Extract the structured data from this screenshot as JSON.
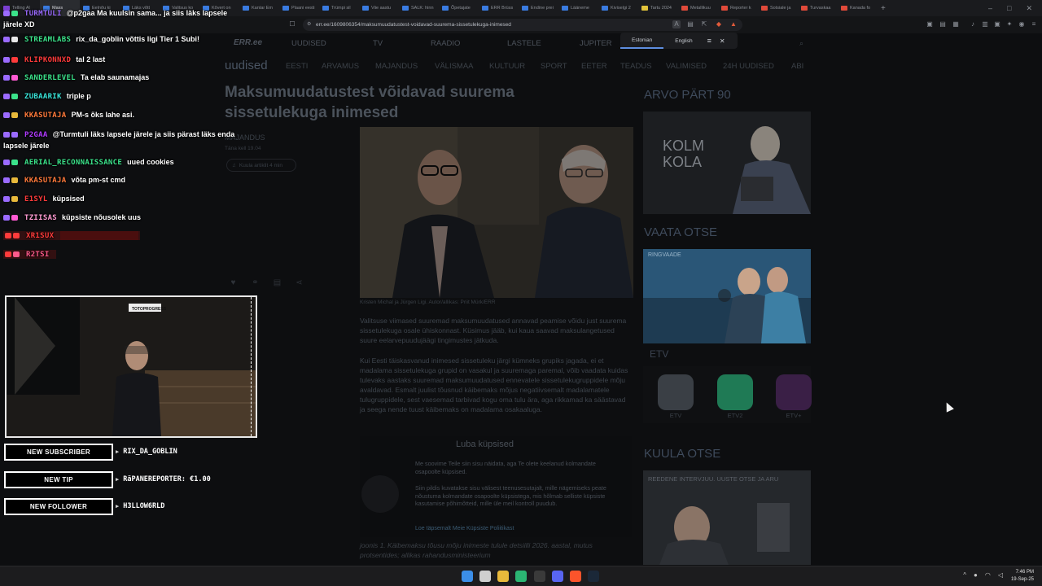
{
  "browser": {
    "tabs": [
      {
        "label": "Telling Al",
        "color": "#7a3fd1"
      },
      {
        "label": "Mass",
        "color": "#3a7be0"
      },
      {
        "label": "Eelnõu ki",
        "color": "#3a7be0"
      },
      {
        "label": "Läks võtt",
        "color": "#3a7be0"
      },
      {
        "label": "Valitsus ko",
        "color": "#3a7be0"
      },
      {
        "label": "Kõvert on",
        "color": "#3a7be0"
      },
      {
        "label": "Kantar Em",
        "color": "#3a7be0"
      },
      {
        "label": "Plaani eesti",
        "color": "#3a7be0"
      },
      {
        "label": "Trümpi sil",
        "color": "#3a7be0"
      },
      {
        "label": "Viie aastu",
        "color": "#3a7be0"
      },
      {
        "label": "SALK: hinn",
        "color": "#3a7be0"
      },
      {
        "label": "Õpetajate",
        "color": "#3a7be0"
      },
      {
        "label": "ERR Brüss",
        "color": "#3a7be0"
      },
      {
        "label": "Endine prei",
        "color": "#3a7be0"
      },
      {
        "label": "Lääneme",
        "color": "#3a7be0"
      },
      {
        "label": "Kiviselgi 2",
        "color": "#3a7be0"
      },
      {
        "label": "Tartu 2024",
        "color": "#e0c23a"
      },
      {
        "label": "Metallikuu",
        "color": "#e04a3a"
      },
      {
        "label": "Reporter k",
        "color": "#e04a3a"
      },
      {
        "label": "Sotsiale ja",
        "color": "#e04a3a"
      },
      {
        "label": "Turvaskaa",
        "color": "#e04a3a"
      },
      {
        "label": "Kanada fo",
        "color": "#e04a3a"
      }
    ],
    "active_tab_index": 1,
    "url": "err.ee/1609806354/maksumuudatustest-voidavad-suurema-sissetulekuga-inimesed",
    "window_buttons": [
      "–",
      "□",
      "✕"
    ]
  },
  "language_popup": {
    "options": [
      "Estonian",
      "English"
    ],
    "selected": "Estonian"
  },
  "site": {
    "logo": "ERR.ee",
    "top_nav": [
      "UUDISED",
      "TV",
      "RAADIO",
      "LASTELE",
      "JUPITER"
    ],
    "section_title": "uudised",
    "sub_nav": [
      "EESTI",
      "ARVAMUS",
      "MAJANDUS",
      "VÄLISMAA",
      "KULTUUR",
      "SPORT",
      "EETER",
      "TEADUS",
      "VALIMISED",
      "24H UUDISED",
      "ABI"
    ],
    "article": {
      "title": "Maksumuudatustest võidavad suurema sissetulekuga inimesed",
      "category": "MAJANDUS",
      "date": "Täna kell 19.04",
      "listen": "Kuula artiklit 4 min",
      "caption": "Kristen Michal ja Jürgen Ligi. Autor/allikas: Priit Mürk/ERR",
      "paragraphs": [
        "Valitsuse viimased suuremad maksumuudatused annavad peamise võidu just suurema sissetulekuga osale ühiskonnast. Küsimus jääb, kui kaua saavad maksulangetused suure eelarvepuudujäägi tingimustes jätkuda.",
        "Kui Eesti täiskasvanud inimesed sissetuleku järgi kümneks grupiks jagada, ei et madalama sissetulekuga grupid on vasakul ja suuremaga paremal, võib vaadata kuidas tulevaks aastaks suuremad maksumuudatused ennevatele sissetulekugruppidele mõju avaldavad. Esmalt juulist tõusnud käibemaks mõjus negatiivsemalt madalamatele tulugruppidele, sest vaesemad tarbivad kogu oma tulu ära, aga rikkamad ka säästavad ja seega nende tuust käibemaks on madalama osakaaluga."
      ],
      "after_cookie": "joonis 1. Käibemaksu tõusu mõju inimeste tulule detsiilli 2026. aastal, mutus protsentides; allikas rahandusministeerium"
    },
    "cookie": {
      "title": "Luba küpsised",
      "text1": "Me soovime Teile siin sisu näidata, aga Te olete keelanud kolmandate osapoolte küpsised.",
      "text2": "Siin pildis kuvatakse sisu välisest teenusesutajalt, mille nägemiseks peate nõustuma kolmandate osapoolte küpsistega, mis hõlmab selliste küpsiste kasutamise põhimõtteid, mille üle meil kontroll puudub.",
      "link": "Loe täpsemalt Meie Küpsiste Poliitikast"
    },
    "sidebar": {
      "arvo_heading": "ARVO PÄRT 90",
      "arvo_card_text": "KOLM KOLA",
      "vaata_heading": "VAATA OTSE",
      "vaata_card_label": "RINGVAADE",
      "etv_label": "ETV",
      "channels": [
        {
          "name": "ETV",
          "color": "#3a3f45"
        },
        {
          "name": "ETV2",
          "color": "#1f7a55"
        },
        {
          "name": "ETV+",
          "color": "#5a2a6a"
        }
      ],
      "kuula_heading": "KUULA OTSE",
      "kuula_text": "REEDENE INTERVJUU. UUSTE OTSE JA ARU"
    }
  },
  "stream_overlay": {
    "chat": [
      {
        "name": "TURMTULI",
        "msg": "@p2gaa Ma kuulsin sama... ja siis läks lapsele järele XD",
        "name_color": "#9b6bff"
      },
      {
        "name": "STREAMLABS",
        "msg": "rix_da_goblin võttis ligi Tier 1 Subi!",
        "name_color": "#3be28a"
      },
      {
        "name": "KLIPKONNXD",
        "msg": "tal 2 last",
        "name_color": "#ff3b3b"
      },
      {
        "name": "SANDERLEVEL",
        "msg": "Ta elab saunamajas",
        "name_color": "#3be28a"
      },
      {
        "name": "ZUBAARIK",
        "msg": "triple p",
        "name_color": "#39e3d8"
      },
      {
        "name": "KKASUTAJA",
        "msg": "PM-s õks lahe asi.",
        "name_color": "#ff7a3b"
      },
      {
        "name": "P2GAA",
        "msg": "@Turmtuli läks lapsele järele ja siis pärast läks enda lapsele järele",
        "name_color": "#b03bff"
      },
      {
        "name": "AERIAL_RECONNAISSANCE",
        "msg": "uued cookies",
        "name_color": "#3be28a"
      },
      {
        "name": "KKASUTAJA",
        "msg": "võta pm-st cmd",
        "name_color": "#ff7a3b"
      },
      {
        "name": "E1SYL",
        "msg": "küpsised",
        "name_color": "#ff3b3b"
      },
      {
        "name": "TZIISAS",
        "msg": "küpsiste nõusolek uus",
        "name_color": "#ff9bd2"
      },
      {
        "name": "XR1SUX",
        "msg": "",
        "name_color": "#ff3b3b"
      },
      {
        "name": "R2TSI",
        "msg": "",
        "name_color": "#ff5a8a"
      }
    ],
    "webcam_banner": "TOTOPROGRESS",
    "alerts": [
      {
        "label": "NEW SUBSCRIBER",
        "value": "RIX_DA_GOBLIN"
      },
      {
        "label": "NEW TIP",
        "value": "RäPANEREPORTER: €1.00"
      },
      {
        "label": "NEW FOLLOWER",
        "value": "H3LLOW6RLD"
      }
    ]
  },
  "taskbar": {
    "apps": [
      {
        "name": "windows-start",
        "color": "#3b8ee8"
      },
      {
        "name": "search",
        "color": "#cfcfcf"
      },
      {
        "name": "file-explorer",
        "color": "#e8b93b"
      },
      {
        "name": "terminal",
        "color": "#2bb673"
      },
      {
        "name": "obs",
        "color": "#3a3a3a"
      },
      {
        "name": "discord",
        "color": "#5865f2"
      },
      {
        "name": "brave",
        "color": "#fb542b"
      },
      {
        "name": "steam",
        "color": "#1b2838"
      }
    ],
    "time": "7:46 PM",
    "date": "19-Sep-25"
  },
  "colors": {
    "accent_blue": "#5e8ee0",
    "page_dark": "#0d0e10"
  }
}
